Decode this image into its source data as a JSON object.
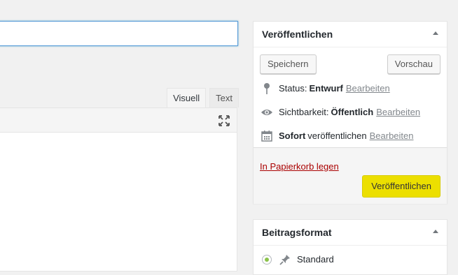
{
  "editor": {
    "title_value": "",
    "tabs": [
      {
        "label": "Visuell",
        "active": true
      },
      {
        "label": "Text",
        "active": false
      }
    ]
  },
  "publish_box": {
    "title": "Veröffentlichen",
    "save_label": "Speichern",
    "preview_label": "Vorschau",
    "status_label": "Status:",
    "status_value": "Entwurf",
    "status_edit": "Bearbeiten",
    "visibility_label": "Sichtbarkeit:",
    "visibility_value": "Öffentlich",
    "visibility_edit": "Bearbeiten",
    "schedule_value": "Sofort",
    "schedule_label": "veröffentlichen",
    "schedule_edit": "Bearbeiten",
    "trash_label": "In Papierkorb legen",
    "publish_label": "Veröffentlichen"
  },
  "format_box": {
    "title": "Beitragsformat",
    "options": [
      {
        "label": "Standard",
        "selected": true
      }
    ]
  },
  "colors": {
    "publish_button": "#ecdf00",
    "trash_link": "#a00000",
    "radio_selected": "#8bc34a"
  }
}
